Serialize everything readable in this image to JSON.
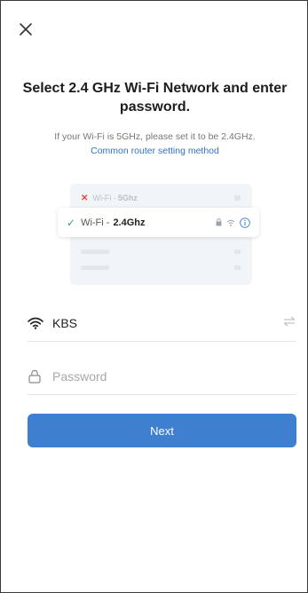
{
  "header": {
    "close_icon": "close-icon"
  },
  "title": "Select 2.4 GHz Wi-Fi Network and enter password.",
  "subtitle": "If your Wi-Fi is 5GHz, please set it to be 2.4GHz.",
  "help_link": "Common router setting method",
  "illustration": {
    "row_5ghz": {
      "prefix": "Wi-Fi - ",
      "band": "5Ghz",
      "status_icon": "x-icon",
      "status_color": "#e04848"
    },
    "row_24ghz": {
      "prefix": "Wi-Fi - ",
      "band": "2.4Ghz",
      "status_icon": "check-icon",
      "status_color": "#3fa96b"
    }
  },
  "network": {
    "icon": "wifi-icon",
    "ssid": "KBS",
    "action_icon": "swap-icon"
  },
  "password": {
    "icon": "lock-icon",
    "placeholder": "Password",
    "value": ""
  },
  "next_button": {
    "label": "Next",
    "color": "#3e7fcf"
  }
}
